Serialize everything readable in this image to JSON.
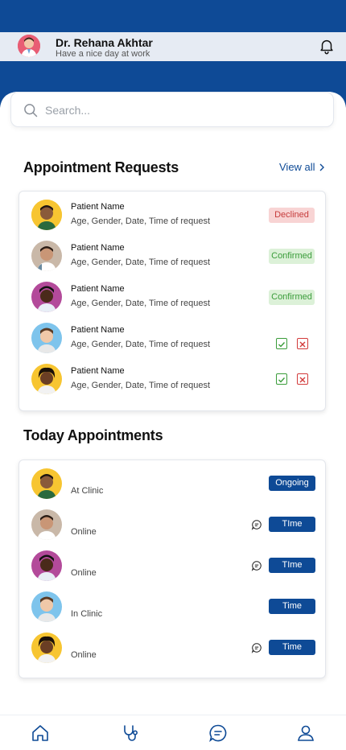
{
  "header": {
    "doctor_name": "Dr. Rehana Akhtar",
    "greeting": "Have a nice day at work"
  },
  "search": {
    "placeholder": "Search..."
  },
  "requests": {
    "title": "Appointment Requests",
    "view_all": "View all",
    "items": [
      {
        "name": "Patient Name",
        "details": "Age, Gender, Date, Time of request",
        "status": "Declined"
      },
      {
        "name": "Patient Name",
        "details": "Age, Gender, Date, Time of request",
        "status": "Confirmed"
      },
      {
        "name": "Patient Name",
        "details": "Age, Gender, Date, Time of request",
        "status": "Confirmed"
      },
      {
        "name": "Patient Name",
        "details": "Age, Gender, Date, Time of request",
        "status": ""
      },
      {
        "name": "Patient Name",
        "details": "Age, Gender, Date, Time of request",
        "status": ""
      }
    ]
  },
  "today": {
    "title": "Today Appointments",
    "items": [
      {
        "mode": "At Clinic",
        "button": "Ongoing"
      },
      {
        "mode": "Online",
        "button": "TIme"
      },
      {
        "mode": "Online",
        "button": "TIme"
      },
      {
        "mode": "In Clinic",
        "button": "Time"
      },
      {
        "mode": "Online",
        "button": "Time"
      }
    ]
  },
  "colors": {
    "primary": "#0e4a96",
    "declined_bg": "#f8d4d4",
    "declined_text": "#c63c3c",
    "confirmed_bg": "#dcf1d8",
    "confirmed_text": "#3a9c3a"
  },
  "icons": [
    "bell-icon",
    "search-icon",
    "chevron-right-icon",
    "check-icon",
    "close-icon",
    "chat-icon",
    "home-icon",
    "stethoscope-icon",
    "message-icon",
    "user-icon"
  ]
}
